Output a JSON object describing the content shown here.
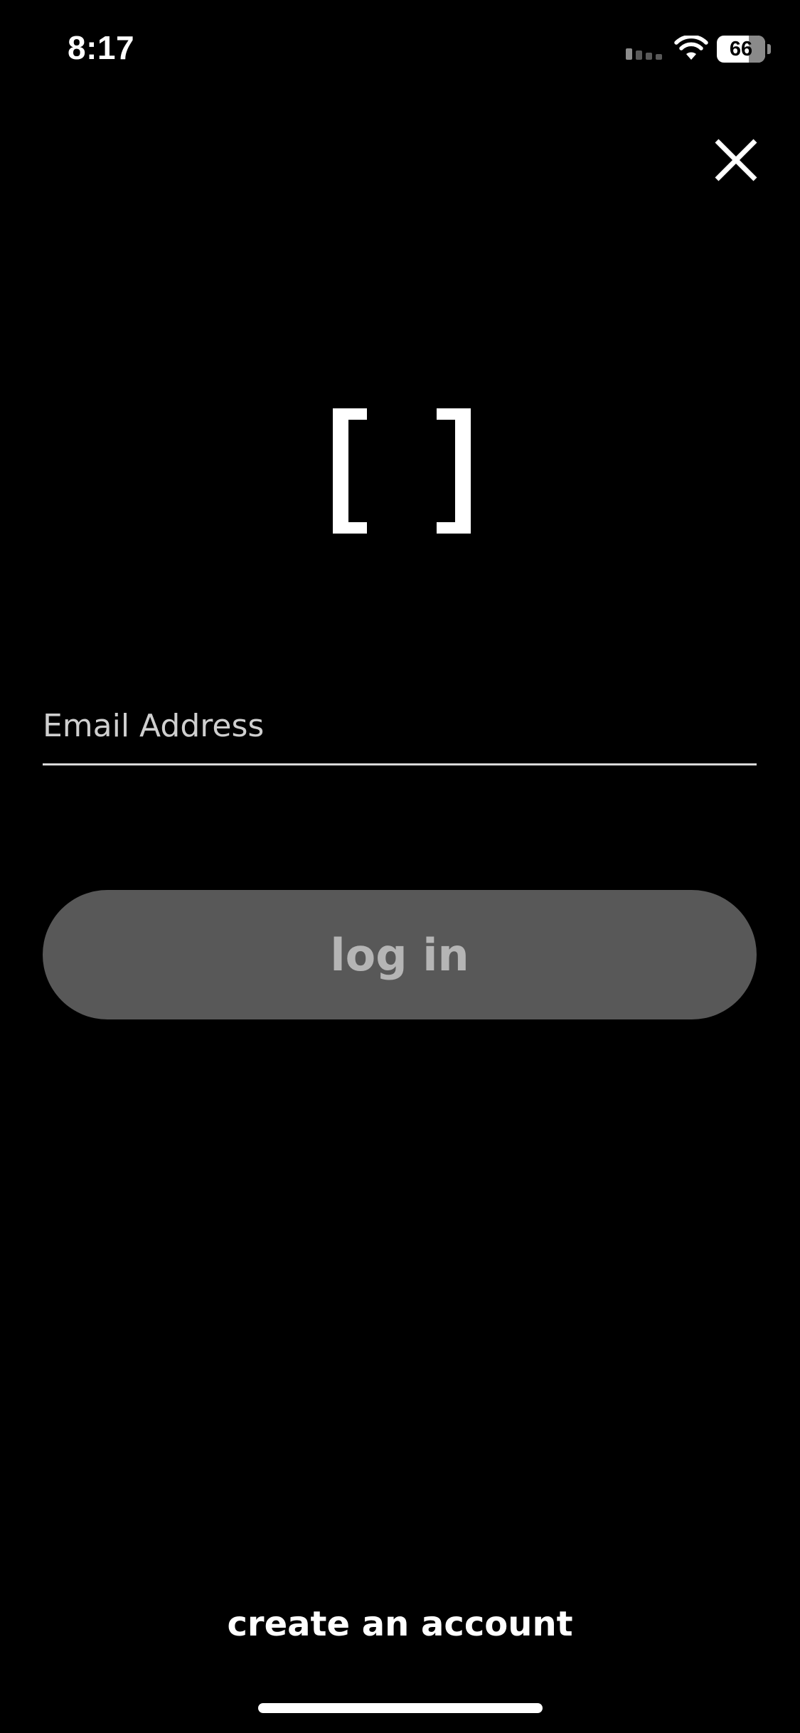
{
  "status_bar": {
    "time": "8:17",
    "battery_level": "66",
    "battery_fraction": 0.66,
    "signal_bars_active": 1,
    "signal_bars_total": 4,
    "icons": [
      "signal-icon",
      "wifi-icon",
      "battery-icon"
    ]
  },
  "header": {
    "close_icon": "close-icon"
  },
  "logo": {
    "icon": "brackets-logo",
    "color": "#ffffff"
  },
  "form": {
    "email_placeholder": "Email Address",
    "email_value": "",
    "login_label": "log in",
    "login_enabled": false
  },
  "footer": {
    "create_account_label": "create an account"
  },
  "colors": {
    "background": "#000000",
    "button_disabled_bg": "#585858",
    "button_disabled_text": "#b5b5b5",
    "underline": "#d9d9d9",
    "text": "#ffffff"
  }
}
